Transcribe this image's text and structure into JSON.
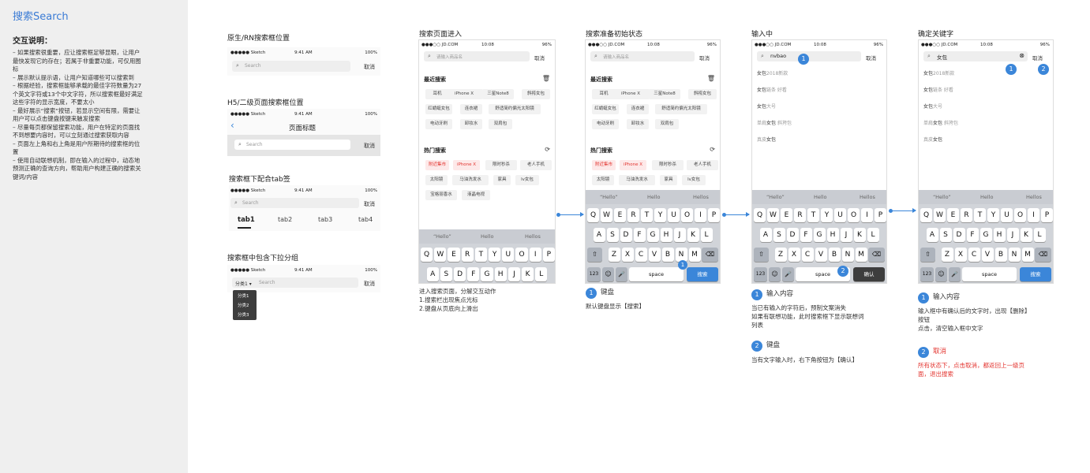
{
  "sidebar": {
    "title": "搜索Search",
    "heading": "交互说明：",
    "lines": [
      "– 如果搜索很重要，应让搜索框足够显眼，让用户",
      "最快发现它的存在；若属于非重要功能，可仅用图",
      "标",
      "– 展示默认提示语，让用户知道哪些可以搜索到",
      "– 根据经验，搜索框能够承载的最佳字符数量为27",
      "个英文字符或13个中文字符，所以搜索框最好满足",
      "这些字符的显示宽度，不要太小",
      "– 最好展示“搜索”按钮，若显示空间有限，需要让",
      "用户可以点击键盘按键来触发搜索",
      "– 尽量每页都保留搜索功能，用户在特定的页面找",
      "不到想要内容时，可以立刻通过搜索获取内容",
      "– 页面左上角和右上角是用户所期待的搜索框的位",
      "置",
      "– 使用自动联想机制，即在输入的过程中，动态地",
      "预测正确的查询方向，帮助用户构建正确的搜索关",
      "键词/内容"
    ]
  },
  "status": {
    "carrier": "●●●●● Sketch",
    "time": "9:41 AM",
    "battery": "100%",
    "jd_carrier": "●●●○○ JD.COM",
    "jd_time": "10:08",
    "jd_battery": "96%"
  },
  "common": {
    "cancel": "取消",
    "search_placeholder": "Search",
    "jd_placeholder": "请输入商品名"
  },
  "panel1": {
    "label": "原生/RN搜索框位置",
    "label2": "H5/二级页面搜索框位置",
    "page_title": "页面标题",
    "label3": "搜索框下配合tab签",
    "tabs": [
      "tab1",
      "tab2",
      "tab3",
      "tab4"
    ],
    "label4": "搜索框中包含下拉分组",
    "dropdown_value": "分类1 ▾",
    "dropdown_items": [
      "分类1",
      "分类2",
      "分类3"
    ]
  },
  "screens": {
    "s1_title": "搜索页面进入",
    "s2_title": "搜索准备初始状态",
    "s3_title": "输入中",
    "s4_title": "确定关键字",
    "recent": "最近搜索",
    "hot": "热门搜索",
    "recent_chips": [
      "耳机",
      "iPhone X",
      "三星Note8",
      "斜挎女包",
      "红蜻蜓女包",
      "连衣裙",
      "舒适简约偏光太阳镜",
      "电动牙刷",
      "卸妆水",
      "双肩包"
    ],
    "hot_chips": [
      "附近集市",
      "iPhone X",
      "限时秒杀",
      "老人手机",
      "太阳镜",
      "马油洗发水",
      "家具",
      "lv女包",
      "宝格丽香水",
      "液晶电视"
    ],
    "s3_input": "nvbao",
    "s4_input": "女包",
    "assoc": [
      {
        "bold": "女包",
        "rest": "2018新款"
      },
      {
        "bold": "女包",
        "rest": "链条 好看"
      },
      {
        "bold": "女包",
        "rest": "大号"
      },
      {
        "pre": "单肩",
        "bold": "女包",
        "rest": " 斜挎包"
      },
      {
        "pre": "真皮",
        "bold": "女包",
        "rest": ""
      }
    ],
    "suggestions": [
      "“Hello”",
      "Hello",
      "Hellos"
    ],
    "keys_row1": [
      "Q",
      "W",
      "E",
      "R",
      "T",
      "Y",
      "U",
      "O",
      "I",
      "P"
    ],
    "keys_row2": [
      "A",
      "S",
      "D",
      "F",
      "G",
      "H",
      "J",
      "K",
      "L"
    ],
    "keys_row3": [
      "Z",
      "X",
      "C",
      "V",
      "B",
      "N",
      "M"
    ],
    "key_123": "123",
    "key_emoji": "☺",
    "key_mic": "🎤",
    "key_space": "space",
    "key_search": "搜索",
    "key_confirm": "确认",
    "s1_desc": [
      "进入搜索页面，分解交互动作",
      "1.搜索栏出现焦点光标",
      "2.键盘从页底向上滑出"
    ],
    "s2_note_num": "1",
    "s2_note_title": "键盘",
    "s2_note_text": "默认键盘显示【搜索】",
    "s3_note1_num": "1",
    "s3_note1_title": "输入内容",
    "s3_note1_text": [
      "当已有输入的字符后，预制文案消失",
      "如果有联想功能，此时搜索框下显示联想词",
      "列表"
    ],
    "s3_note2_num": "2",
    "s3_note2_title": "键盘",
    "s3_note2_text": "当有文字输入时，右下角按钮为【确认】",
    "s4_note1_num": "1",
    "s4_note1_title": "输入内容",
    "s4_note1_text": [
      "输入框中有确认后的文字时，出现【删除】",
      "按钮",
      "点击，清空输入框中文字"
    ],
    "s4_note2_num": "2",
    "s4_note2_title": "取消",
    "s4_note2_text": [
      "所有状态下，点击取消，都返回上一级页",
      "面，退出搜索"
    ]
  },
  "colors": {
    "accent": "#3b86d9",
    "red": "#e3342f"
  }
}
